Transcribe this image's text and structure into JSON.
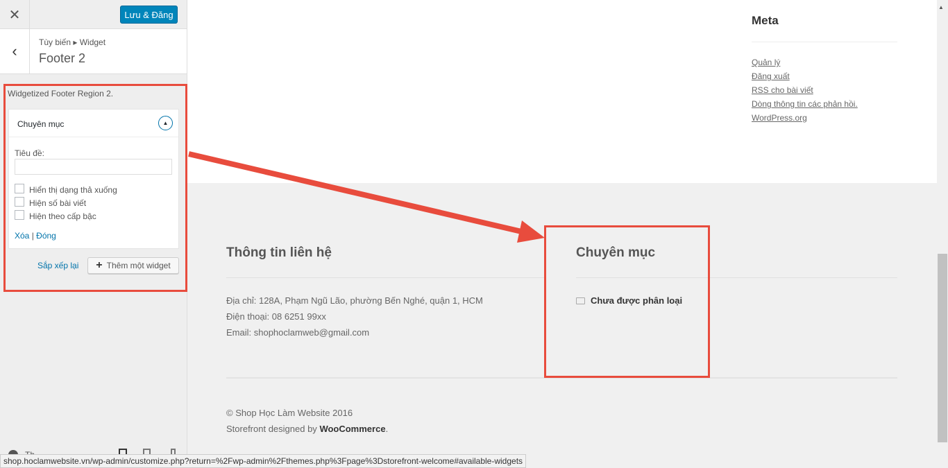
{
  "sidebar": {
    "close_icon": "close-icon",
    "save_label": "Lưu & Đăng",
    "breadcrumb": "Tùy biến ▸ Widget",
    "section_title": "Footer 2",
    "description": "Widgetized Footer Region 2.",
    "widget": {
      "title": "Chuyên mục",
      "title_label": "Tiêu đề:",
      "title_value": "",
      "checkboxes": [
        {
          "label": "Hiển thị dạng thả xuống",
          "checked": false
        },
        {
          "label": "Hiện số bài viết",
          "checked": false
        },
        {
          "label": "Hiện theo cấp bậc",
          "checked": false
        }
      ],
      "delete_label": "Xóa",
      "separator": "|",
      "close_label": "Đóng"
    },
    "reorder_label": "Sắp xếp lại",
    "add_widget_label": "Thêm một widget",
    "footer_label": "Th"
  },
  "preview": {
    "meta": {
      "title": "Meta",
      "links": [
        "Quản lý",
        "Đăng xuất",
        "RSS cho bài viết",
        "Dòng thông tin các phản hồi.",
        "WordPress.org"
      ]
    },
    "contact": {
      "title": "Thông tin liên hệ",
      "lines": [
        "Địa chỉ: 128A, Phạm Ngũ Lão, phường Bến Nghé, quận 1, HCM",
        "Điện thoại: 08 6251 99xx",
        "Email: shophoclamweb@gmail.com"
      ]
    },
    "categories": {
      "title": "Chuyên mục",
      "items": [
        "Chưa được phân loại"
      ]
    },
    "credit": {
      "copyright": "© Shop Học Làm Website 2016",
      "designed_by": "Storefront designed by",
      "brand": "WooCommerce",
      "period": "."
    }
  },
  "status_url": "shop.hoclamwebsite.vn/wp-admin/customize.php?return=%2Fwp-admin%2Fthemes.php%3Fpage%3Dstorefront-welcome#available-widgets",
  "colors": {
    "accent": "#0085ba",
    "annotation": "#e84c3d"
  }
}
